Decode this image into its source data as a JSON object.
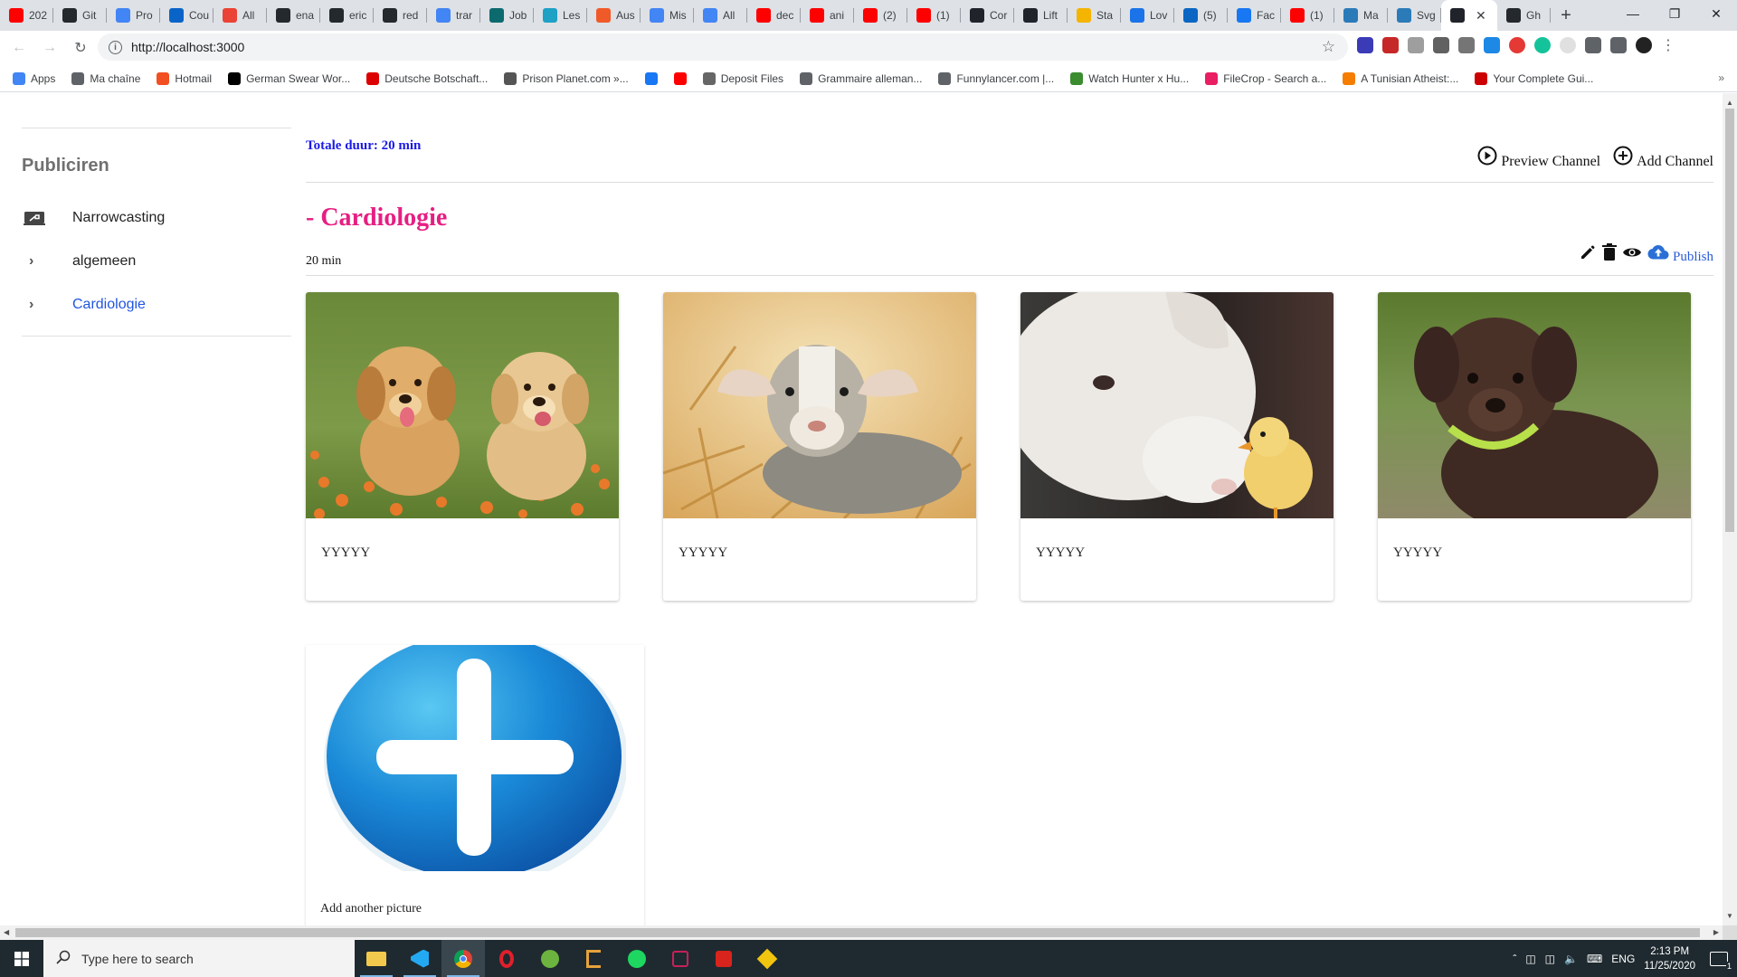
{
  "browser": {
    "tabs": [
      {
        "label": "202",
        "icon": "youtube-icon",
        "color": "#ff0000"
      },
      {
        "label": "Git",
        "icon": "github-icon",
        "color": "#24292e"
      },
      {
        "label": "Pro",
        "icon": "google-icon",
        "color": "#4285f4"
      },
      {
        "label": "Cou",
        "icon": "outlook-icon",
        "color": "#0a64c8"
      },
      {
        "label": "All",
        "icon": "gmail-icon",
        "color": "#ea4335"
      },
      {
        "label": "ena",
        "icon": "github-icon",
        "color": "#24292e"
      },
      {
        "label": "eric",
        "icon": "github-icon",
        "color": "#24292e"
      },
      {
        "label": "red",
        "icon": "github-icon",
        "color": "#24292e"
      },
      {
        "label": "trar",
        "icon": "google-icon",
        "color": "#4285f4"
      },
      {
        "label": "Job",
        "icon": "xing-icon",
        "color": "#0c6a6e"
      },
      {
        "label": "Les",
        "icon": "slack-icon",
        "color": "#1da1c5"
      },
      {
        "label": "Aus",
        "icon": "site-icon",
        "color": "#f05a28"
      },
      {
        "label": "Mis",
        "icon": "google-icon",
        "color": "#4285f4"
      },
      {
        "label": "All",
        "icon": "google-icon",
        "color": "#4285f4"
      },
      {
        "label": "dec",
        "icon": "youtube-icon",
        "color": "#ff0000"
      },
      {
        "label": "ani",
        "icon": "youtube-icon",
        "color": "#ff0000"
      },
      {
        "label": "(2)",
        "icon": "youtube-icon",
        "color": "#ff0000"
      },
      {
        "label": "(1)",
        "icon": "youtube-icon",
        "color": "#ff0000"
      },
      {
        "label": "Cor",
        "icon": "react-icon",
        "color": "#20232a"
      },
      {
        "label": "Lift",
        "icon": "react-icon",
        "color": "#20232a"
      },
      {
        "label": "Sta",
        "icon": "chart-icon",
        "color": "#f4b400"
      },
      {
        "label": "Lov",
        "icon": "site-icon",
        "color": "#1a73e8"
      },
      {
        "label": "(5)",
        "icon": "linkedin-icon",
        "color": "#0a66c2"
      },
      {
        "label": "Fac",
        "icon": "facebook-icon",
        "color": "#1877f2"
      },
      {
        "label": "(1)",
        "icon": "youtube-icon",
        "color": "#ff0000"
      },
      {
        "label": "Ma",
        "icon": "site-icon",
        "color": "#2b7bb9"
      },
      {
        "label": "Svg",
        "icon": "site-icon",
        "color": "#2b7bb9"
      }
    ],
    "active_tab": {
      "label": "",
      "icon": "react-icon",
      "color": "#20232a"
    },
    "last_tab": {
      "label": "Gh",
      "icon": "github-icon",
      "color": "#24292e"
    },
    "url": "http://localhost:3000",
    "bookmarks": [
      {
        "label": "Apps",
        "icon": "apps-icon",
        "color": "#4285f4"
      },
      {
        "label": "Ma chaîne",
        "icon": "site-icon",
        "color": "#5f6368"
      },
      {
        "label": "Hotmail",
        "icon": "windows-icon",
        "color": "#f25022"
      },
      {
        "label": "German Swear Wor...",
        "icon": "exclaim-icon",
        "color": "#000000"
      },
      {
        "label": "Deutsche Botschaft...",
        "icon": "flag-icon",
        "color": "#dd0000"
      },
      {
        "label": "Prison Planet.com »...",
        "icon": "site-icon",
        "color": "#555555"
      },
      {
        "label": "",
        "icon": "facebook-icon",
        "color": "#1877f2"
      },
      {
        "label": "",
        "icon": "youtube-icon",
        "color": "#ff0000"
      },
      {
        "label": "Deposit Files",
        "icon": "site-icon",
        "color": "#666666"
      },
      {
        "label": "Grammaire alleman...",
        "icon": "site-icon",
        "color": "#5f6368"
      },
      {
        "label": "Funnylancer.com |...",
        "icon": "site-icon",
        "color": "#5f6368"
      },
      {
        "label": "Watch Hunter x Hu...",
        "icon": "site-icon",
        "color": "#3a8c2f"
      },
      {
        "label": "FileCrop - Search a...",
        "icon": "site-icon",
        "color": "#e91e63"
      },
      {
        "label": "A Tunisian Atheist:...",
        "icon": "blogger-icon",
        "color": "#f57d00"
      },
      {
        "label": "Your Complete Gui...",
        "icon": "rh-icon",
        "color": "#cc0000"
      }
    ]
  },
  "sidebar": {
    "title": "Publiciren",
    "items": [
      {
        "label": "Narrowcasting",
        "icon": "screen-icon"
      },
      {
        "label": "algemeen",
        "icon": "chevron-right-icon"
      },
      {
        "label": "Cardiologie",
        "icon": "chevron-right-icon",
        "active": true
      }
    ]
  },
  "main": {
    "total_duration": "Totale duur: 20 min",
    "preview_channel": "Preview Channel",
    "add_channel": "Add Channel",
    "channel": {
      "title": "- Cardiologie",
      "duration": "20 min",
      "publish_label": "Publish",
      "cards": [
        {
          "caption": "YYYYY",
          "image": "two-golden-puppies"
        },
        {
          "caption": "YYYYY",
          "image": "baby-goat-in-straw"
        },
        {
          "caption": "YYYYY",
          "image": "lamb-and-chick"
        },
        {
          "caption": "YYYYY",
          "image": "brown-labrador-puppy"
        }
      ],
      "add_picture_label": "Add another picture"
    }
  },
  "taskbar": {
    "search_placeholder": "Type here to search",
    "lang": "ENG",
    "time": "2:13 PM",
    "date": "11/25/2020",
    "notification_count": "1"
  },
  "colors": {
    "accent_pink": "#e61f82",
    "link_blue": "#2155e0",
    "total_blue": "#1a1ae6"
  }
}
